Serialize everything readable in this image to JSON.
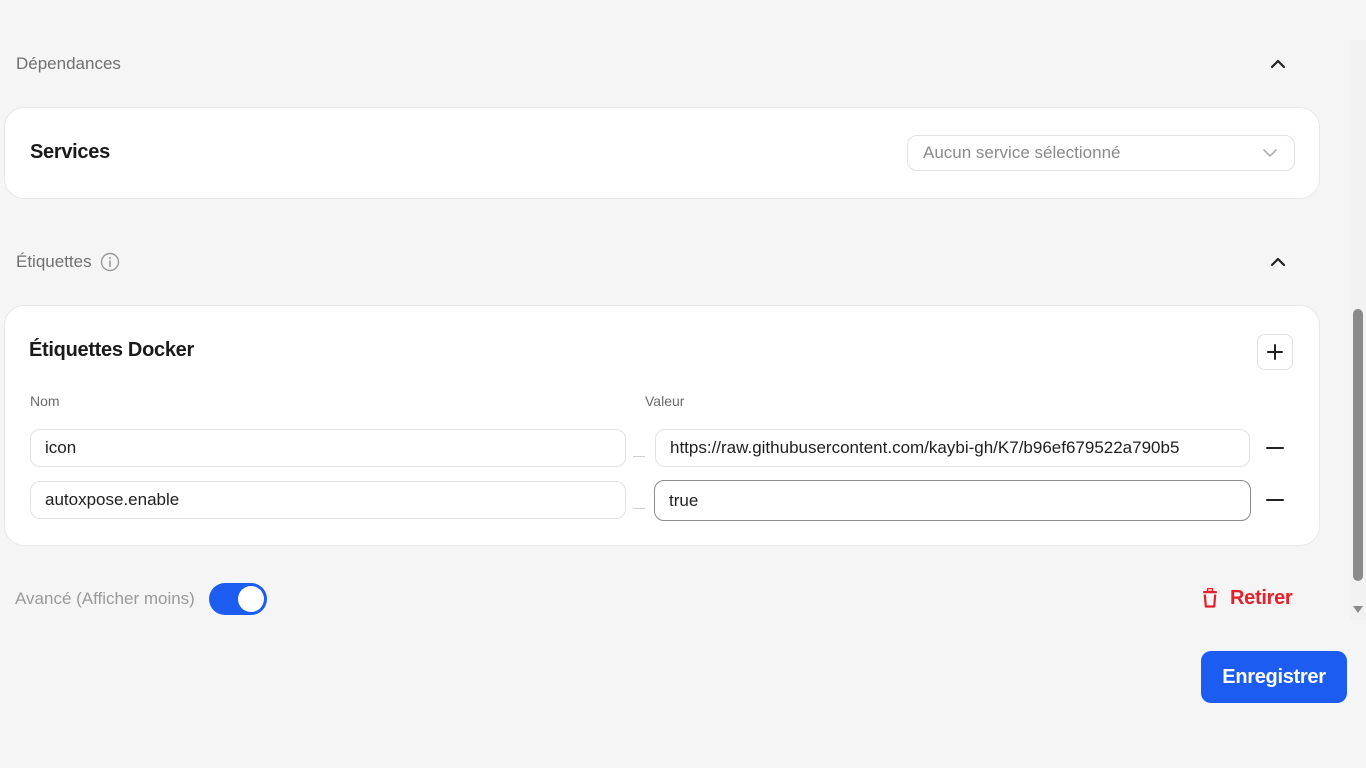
{
  "dependencies": {
    "title": "Dépendances",
    "services_title": "Services",
    "services_select_placeholder": "Aucun service sélectionné"
  },
  "labels": {
    "title": "Étiquettes",
    "docker_title": "Étiquettes Docker",
    "col_name": "Nom",
    "col_value": "Valeur",
    "rows": [
      {
        "name": "icon",
        "value": "https://raw.githubusercontent.com/kaybi-gh/K7/b96ef679522a790b5"
      },
      {
        "name": "autoxpose.enable",
        "value": "true"
      }
    ]
  },
  "advanced": {
    "label": "Avancé (Afficher moins)",
    "enabled": true
  },
  "actions": {
    "remove_label": "Retirer",
    "save_label": "Enregistrer"
  },
  "colors": {
    "accent": "#1d5cf0",
    "danger": "#e5202a"
  }
}
